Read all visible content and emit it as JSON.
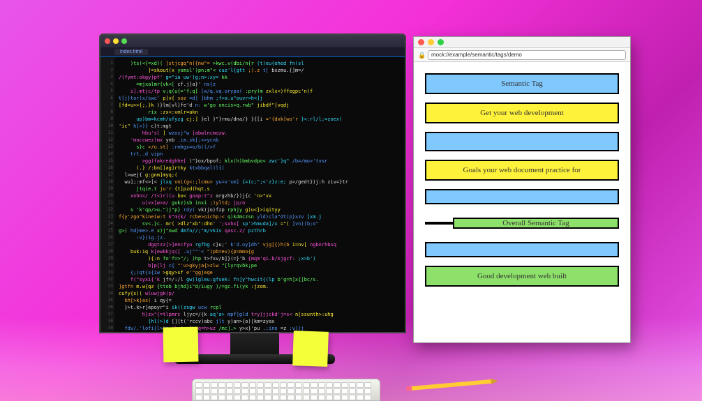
{
  "editor": {
    "tabs": [
      "index.html"
    ],
    "line_count": 40
  },
  "browser": {
    "url": "mock://example/semantic/tags/demo",
    "boxes": [
      {
        "type": "blue",
        "label": "Semantic Tag"
      },
      {
        "type": "yellow",
        "label": "Get your web development"
      },
      {
        "type": "blue-tall",
        "label": ""
      },
      {
        "type": "yellow",
        "label": "Goals your web document practice for"
      },
      {
        "type": "blue-med",
        "label": ""
      },
      {
        "type": "split-green",
        "label": "Overall Semantic Tag"
      },
      {
        "type": "blue-med",
        "label": ""
      },
      {
        "type": "green",
        "label": "Good development web built"
      }
    ]
  }
}
